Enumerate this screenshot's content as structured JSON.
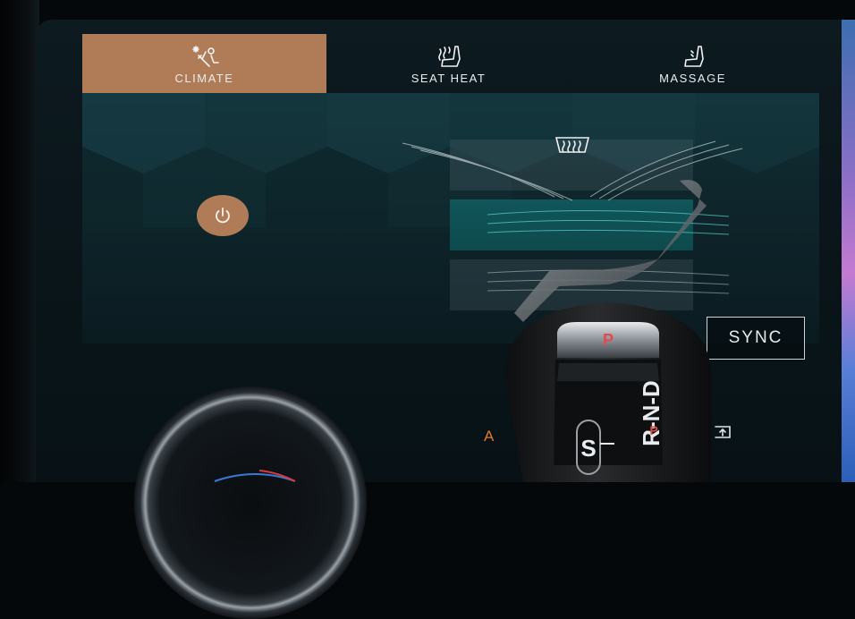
{
  "tabs": [
    {
      "label": "CLIMATE",
      "icon": "climate-icon",
      "active": true
    },
    {
      "label": "SEAT HEAT",
      "icon": "seat-heat-icon",
      "active": false
    },
    {
      "label": "MASSAGE",
      "icon": "massage-icon",
      "active": false
    }
  ],
  "climate": {
    "power_icon": "power-icon",
    "defrost_icon": "rear-defrost-icon",
    "sync_label": "SYNC",
    "auto_label": "A"
  },
  "shifter": {
    "park_button": "P",
    "gears": "R-N-D",
    "park_indicator": "P",
    "sport_manual": "S"
  },
  "colors": {
    "accent": "#b07c58",
    "auto": "#e27a2b",
    "park_red": "#e34b4b"
  }
}
